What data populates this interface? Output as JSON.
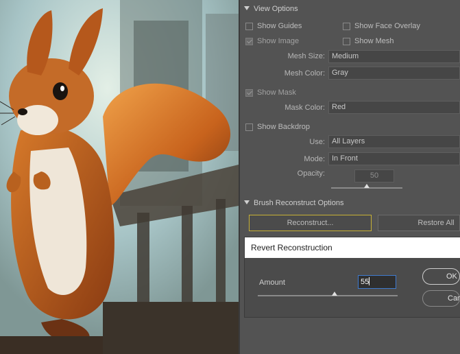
{
  "view_options": {
    "title": "View Options",
    "show_guides": {
      "label": "Show Guides",
      "checked": false
    },
    "show_face_overlay": {
      "label": "Show Face Overlay",
      "checked": false
    },
    "show_image": {
      "label": "Show Image",
      "checked": true
    },
    "show_mesh": {
      "label": "Show Mesh",
      "checked": false
    },
    "mesh_size": {
      "label": "Mesh Size:",
      "value": "Medium"
    },
    "mesh_color": {
      "label": "Mesh Color:",
      "value": "Gray"
    }
  },
  "mask": {
    "show_mask": {
      "label": "Show Mask",
      "checked": true
    },
    "mask_color": {
      "label": "Mask Color:",
      "value": "Red"
    }
  },
  "backdrop": {
    "show_backdrop": {
      "label": "Show Backdrop",
      "checked": false
    },
    "use": {
      "label": "Use:",
      "value": "All Layers"
    },
    "mode": {
      "label": "Mode:",
      "value": "In Front"
    },
    "opacity": {
      "label": "Opacity:",
      "value": "50"
    }
  },
  "brush_reconstruct": {
    "title": "Brush Reconstruct Options",
    "reconstruct_label": "Reconstruct...",
    "restore_all_label": "Restore All"
  },
  "dialog": {
    "title": "Revert Reconstruction",
    "amount_label": "Amount",
    "amount_value": "55",
    "ok_label": "OK",
    "cancel_label": "Cancel"
  },
  "colors": {
    "panel_bg": "#535353",
    "field_bg": "#464646",
    "focus_border": "#c9b236",
    "input_focus": "#3f7bd0"
  },
  "icons": [
    "section-collapse-icon",
    "checkbox-icon",
    "slider-knob-icon",
    "text-caret-icon"
  ]
}
